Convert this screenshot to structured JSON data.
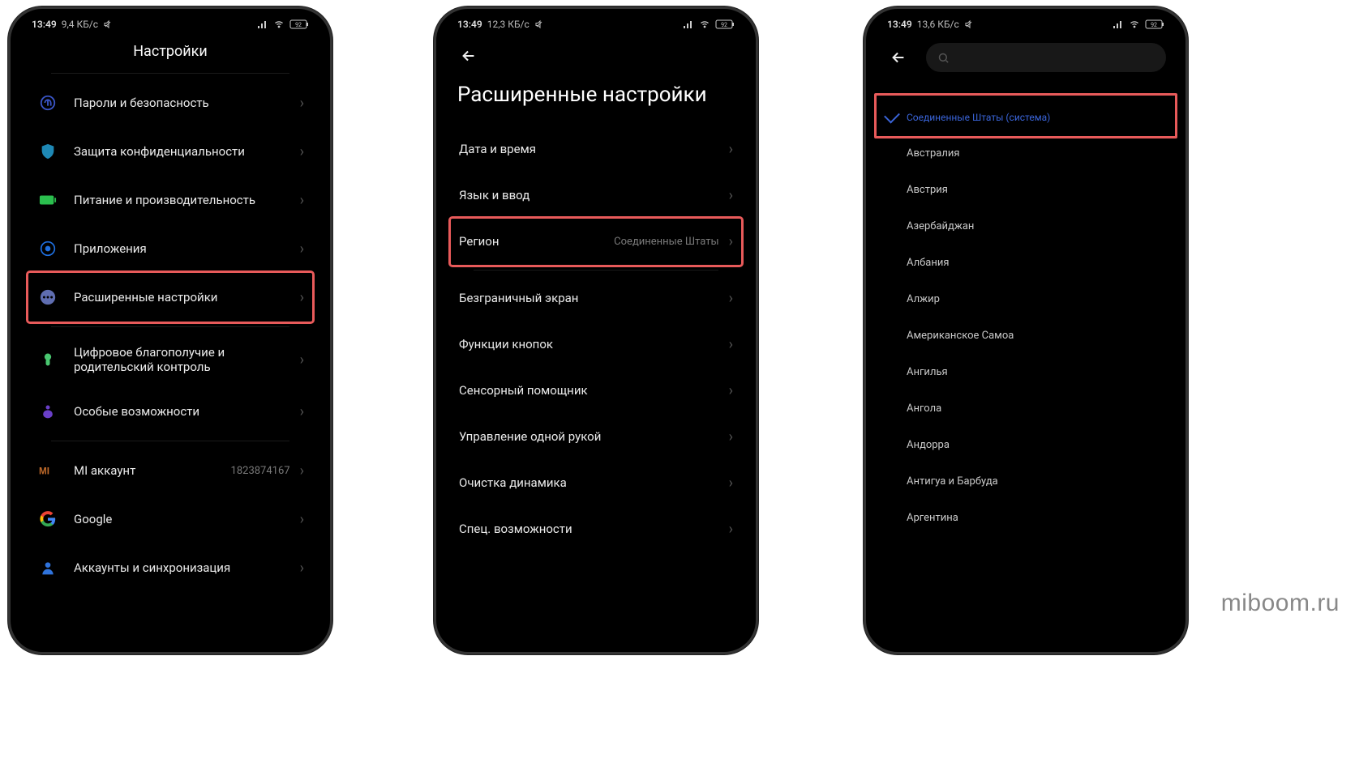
{
  "watermark": "miboom.ru",
  "phone1": {
    "status": {
      "clock": "13:49",
      "speed": "9,4 КБ/с",
      "battery": "92"
    },
    "title": "Настройки",
    "items": [
      {
        "icon": "fingerprint",
        "color": "#3a55c7",
        "label": "Пароли и безопасность"
      },
      {
        "icon": "shield",
        "color": "#1e88b5",
        "label": "Защита конфиденциальности"
      },
      {
        "icon": "battery",
        "color": "#2bbf4e",
        "label": "Питание и производительность"
      },
      {
        "icon": "apps",
        "color": "#1e6fe0",
        "label": "Приложения"
      },
      {
        "icon": "dots",
        "color": "#5f6db0",
        "label": "Расширенные настройки",
        "highlight": true
      }
    ],
    "items2": [
      {
        "icon": "heart",
        "color": "#49c770",
        "label": "Цифровое благополучие и родительский контроль"
      },
      {
        "icon": "access",
        "color": "#6a3fc8",
        "label": "Особые возможности"
      }
    ],
    "items3": [
      {
        "icon": "mi",
        "color": "#c06a2a",
        "label": "MI аккаунт",
        "value": "1823874167"
      },
      {
        "icon": "google",
        "color": "#fff",
        "label": "Google"
      },
      {
        "icon": "person",
        "color": "#2f73dc",
        "label": "Аккаунты и синхронизация"
      }
    ]
  },
  "phone2": {
    "status": {
      "clock": "13:49",
      "speed": "12,3 КБ/с",
      "battery": "92"
    },
    "title": "Расширенные настройки",
    "items1": [
      {
        "label": "Дата и время"
      },
      {
        "label": "Язык и ввод"
      },
      {
        "label": "Регион",
        "value": "Соединенные Штаты",
        "highlight": true
      }
    ],
    "items2": [
      {
        "label": "Безграничный экран"
      },
      {
        "label": "Функции кнопок"
      },
      {
        "label": "Сенсорный помощник"
      },
      {
        "label": "Управление одной рукой"
      },
      {
        "label": "Очистка динамика"
      },
      {
        "label": "Спец. возможности"
      }
    ]
  },
  "phone3": {
    "status": {
      "clock": "13:49",
      "speed": "13,6 КБ/с",
      "battery": "92"
    },
    "search_placeholder": "",
    "selected": "Соединенные Штаты (система)",
    "regions": [
      "Австралия",
      "Австрия",
      "Азербайджан",
      "Албания",
      "Алжир",
      "Американское Самоа",
      "Ангилья",
      "Ангола",
      "Андорра",
      "Антигуа и Барбуда",
      "Аргентина"
    ]
  }
}
